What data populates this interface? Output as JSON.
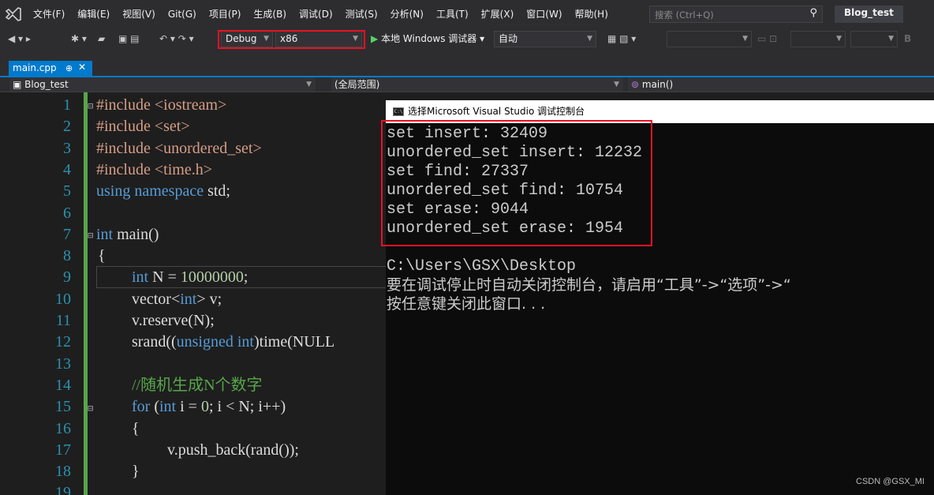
{
  "menubar": {
    "items": [
      "文件(F)",
      "编辑(E)",
      "视图(V)",
      "Git(G)",
      "项目(P)",
      "生成(B)",
      "调试(D)",
      "测试(S)",
      "分析(N)",
      "工具(T)",
      "扩展(X)",
      "窗口(W)",
      "帮助(H)"
    ],
    "search_placeholder": "搜索 (Ctrl+Q)",
    "solution": "Blog_test"
  },
  "toolbar": {
    "config": "Debug",
    "platform": "x86",
    "run_label": "本地 Windows 调试器",
    "run_mode": "自动",
    "letter": "B"
  },
  "tabs": {
    "active": "main.cpp",
    "pin": "⊕",
    "close": "✕"
  },
  "navbar": {
    "project": "Blog_test",
    "scope": "(全局范围)",
    "member": "main()"
  },
  "editor": {
    "line_numbers": [
      "1",
      "2",
      "3",
      "4",
      "5",
      "6",
      "7",
      "8",
      "9",
      "10",
      "11",
      "12",
      "13",
      "14",
      "15",
      "16",
      "17",
      "18",
      "19"
    ],
    "lines": {
      "l1": "#include <iostream>",
      "l2": "#include <set>",
      "l3": "#include <unordered_set>",
      "l4": "#include <time.h>",
      "l5_kw1": "using",
      "l5_kw2": "namespace",
      "l5_rest": " std;",
      "l7_kw": "int",
      "l7_rest": " main()",
      "l8": "{",
      "l9_kw": "int",
      "l9_rest": " N = ",
      "l9_num": "10000000",
      "l9_end": ";",
      "l10_a": "vector<",
      "l10_kw": "int",
      "l10_b": "> v;",
      "l11": "v.reserve(N);",
      "l12_a": "srand((",
      "l12_kw1": "unsigned",
      "l12_sp": " ",
      "l12_kw2": "int",
      "l12_b": ")time(NULL",
      "l14": "//随机生成N个数字",
      "l15_kw1": "for",
      "l15_a": " (",
      "l15_kw2": "int",
      "l15_b": " i = ",
      "l15_num": "0",
      "l15_c": "; i < N; i++)",
      "l16": "{",
      "l17": "v.push_back(rand());",
      "l18": "}"
    }
  },
  "console": {
    "title": "选择Microsoft Visual Studio 调试控制台",
    "output": [
      "set insert: 32409",
      "unordered_set insert: 12232",
      "set find: 27337",
      "unordered_set find: 10754",
      "set erase: 9044",
      "unordered_set erase: 1954"
    ],
    "path": "C:\\Users\\GSX\\Desktop",
    "hint": "要在调试停止时自动关闭控制台，请启用“工具”->“选项”->“",
    "press_key": "按任意键关闭此窗口. . ."
  },
  "watermark": "CSDN @GSX_MI",
  "colors": {
    "accent": "#007acc",
    "highlight": "#e81123",
    "keyword": "#569cd6",
    "string": "#d69d85",
    "comment": "#57a64a",
    "linenum": "#2b91af"
  }
}
